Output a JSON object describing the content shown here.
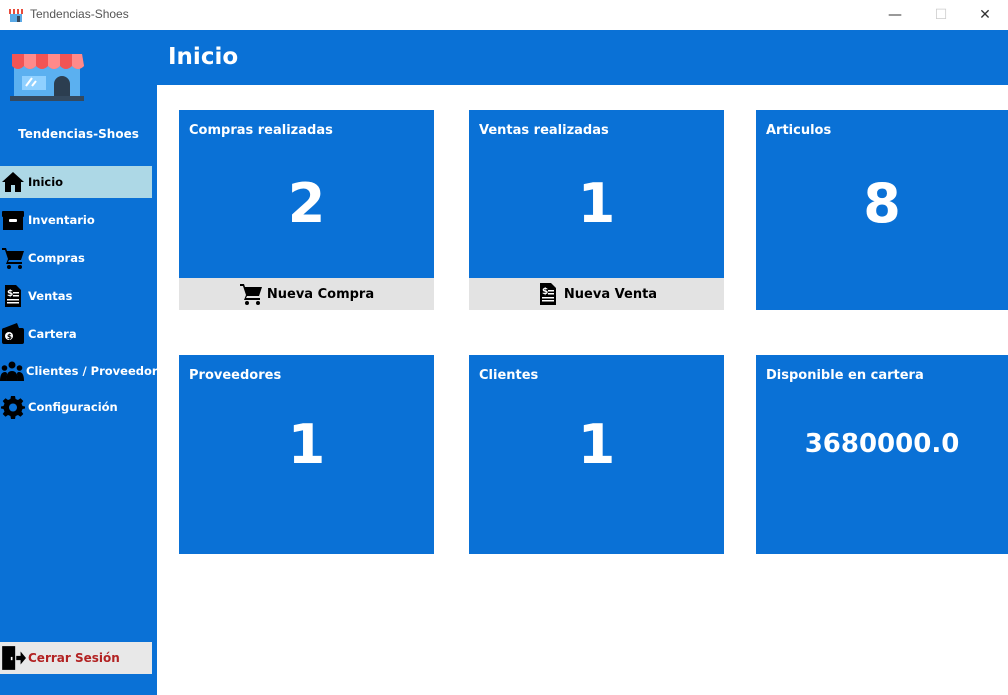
{
  "window": {
    "title": "Tendencias-Shoes",
    "minimize_glyph": "—",
    "maximize_glyph": "☐",
    "close_glyph": "✕"
  },
  "sidebar": {
    "brand": "Tendencias-Shoes",
    "items": [
      {
        "label": "Inicio",
        "icon": "home-icon",
        "active": true
      },
      {
        "label": "Inventario",
        "icon": "box-icon"
      },
      {
        "label": "Compras",
        "icon": "cart-icon"
      },
      {
        "label": "Ventas",
        "icon": "invoice-icon"
      },
      {
        "label": "Cartera",
        "icon": "wallet-icon"
      },
      {
        "label": "Clientes / Proveedores",
        "icon": "people-icon"
      },
      {
        "label": "Configuración",
        "icon": "gear-icon"
      }
    ],
    "logout_label": "Cerrar Sesión"
  },
  "header": {
    "title": "Inicio"
  },
  "cards": [
    {
      "title": "Compras realizadas",
      "value": "2",
      "action": "Nueva Compra"
    },
    {
      "title": "Ventas realizadas",
      "value": "1",
      "action": "Nueva Venta"
    },
    {
      "title": "Articulos",
      "value": "8"
    },
    {
      "title": "Proveedores",
      "value": "1"
    },
    {
      "title": "Clientes",
      "value": "1"
    },
    {
      "title": "Disponible en cartera",
      "value": "3680000.0"
    }
  ],
  "colors": {
    "accent": "#0a71d6",
    "active_nav": "#add8e6",
    "action_bg": "#e3e3e3",
    "logout_text": "#b22222"
  }
}
